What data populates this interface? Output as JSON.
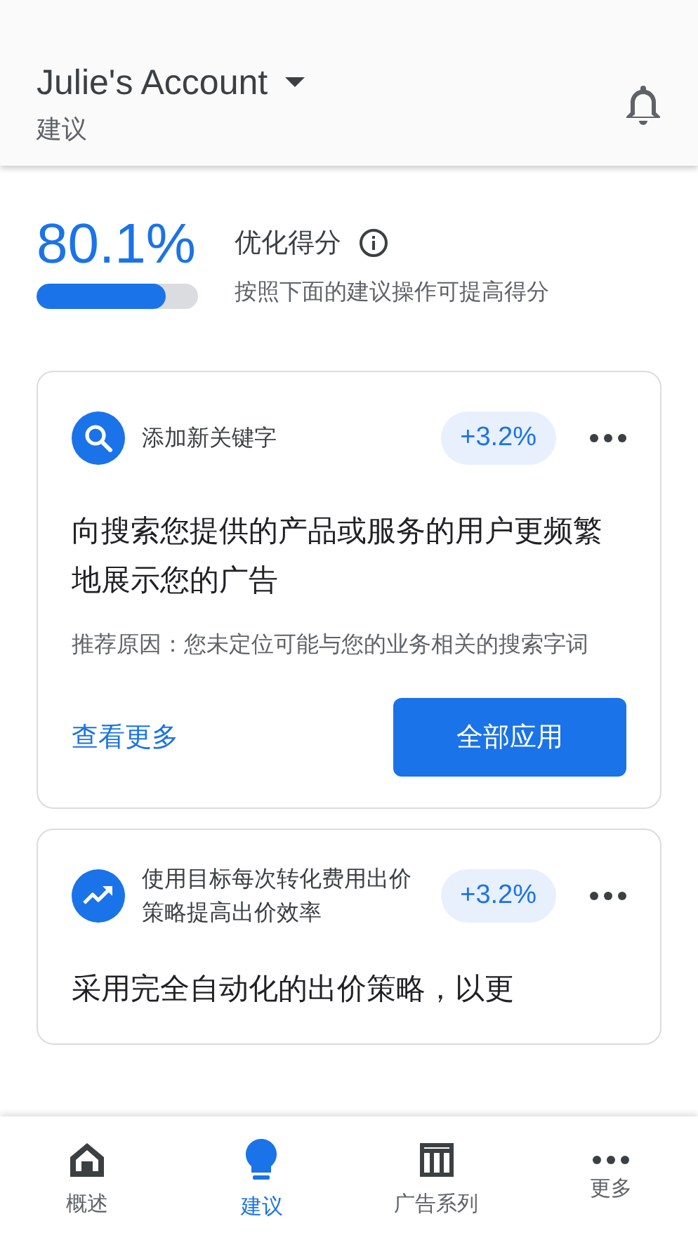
{
  "header": {
    "account": "Julie's Account",
    "subtitle": "建议"
  },
  "score": {
    "value": "80.1%",
    "level": 0.801,
    "title": "优化得分",
    "description": "按照下面的建议操作可提高得分"
  },
  "cards": [
    {
      "kind": "search",
      "category": "添加新关键字",
      "uplift": "+3.2%",
      "title": "向搜索您提供的产品或服务的用户更频繁地展示您的广告",
      "reason": "推荐原因：您未定位可能与您的业务相关的搜索字词",
      "link": "查看更多",
      "action": "全部应用"
    },
    {
      "kind": "trend",
      "category": "使用目标每次转化费用出价策略提高出价效率",
      "uplift": "+3.2%",
      "title": "采用完全自动化的出价策略，以更"
    }
  ],
  "nav": [
    {
      "kind": "home",
      "label": "概述",
      "selected": false
    },
    {
      "kind": "bulb",
      "label": "建议",
      "selected": true
    },
    {
      "kind": "table",
      "label": "广告系列",
      "selected": false
    },
    {
      "kind": "more",
      "label": "更多",
      "selected": false
    }
  ]
}
